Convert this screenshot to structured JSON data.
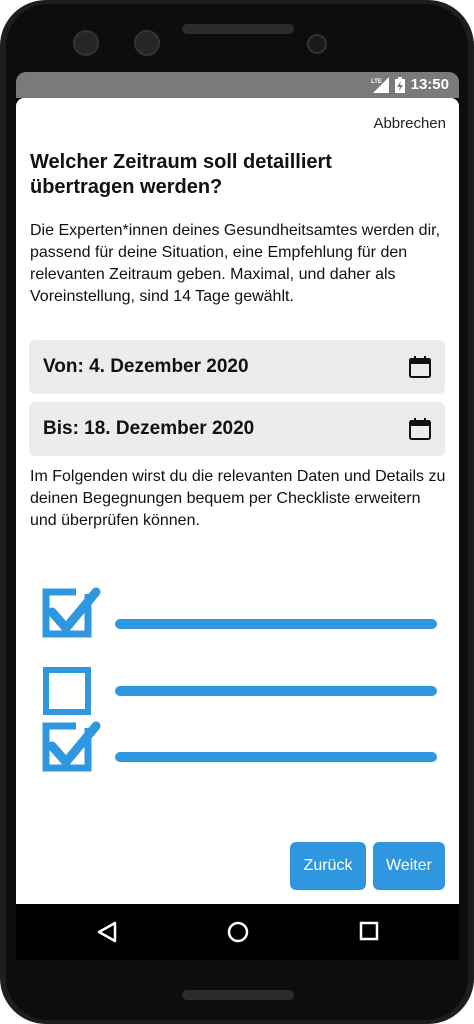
{
  "status_bar": {
    "network": "LTE",
    "time": "13:50",
    "icons": [
      "lte-signal-icon",
      "battery-charging-icon"
    ]
  },
  "header": {
    "cancel_label": "Abbrechen"
  },
  "main": {
    "title": "Welcher Zeitraum soll detailliert übertragen werden?",
    "description": "Die Experten*innen deines Gesundheitsamtes werden dir, passend für deine Situation, eine Empfehlung für den relevanten Zeitraum geben. Maximal, und daher als Voreinstellung, sind 14 Tage gewählt.",
    "date_from": "Von: 4. Dezember 2020",
    "date_to": "Bis: 18. Dezember 2020",
    "info": "Im Folgenden wirst du die relevanten Daten und Details zu deinen Begegnungen bequem per Checkliste erweitern und überprüfen können."
  },
  "illustration": {
    "accent_color": "#2f97df",
    "items": [
      {
        "checked": true
      },
      {
        "checked": false
      },
      {
        "checked": true
      }
    ]
  },
  "footer": {
    "back_label": "Zurück",
    "next_label": "Weiter"
  },
  "nav": {
    "icons": [
      "back-triangle-icon",
      "home-circle-icon",
      "recents-square-icon"
    ]
  }
}
